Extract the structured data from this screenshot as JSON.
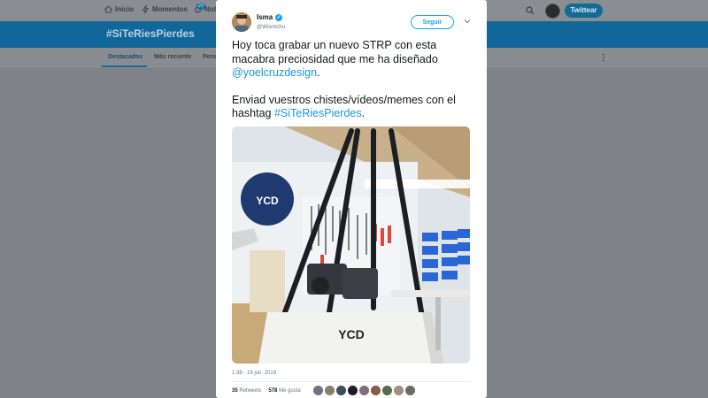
{
  "topnav": {
    "items": [
      {
        "label": "Inicio",
        "icon": "home-icon"
      },
      {
        "label": "Momentos",
        "icon": "lightning-icon"
      },
      {
        "label": "Noti",
        "icon": "bell-icon"
      }
    ],
    "notification_badge": "20",
    "tweet_button": "Twittear"
  },
  "banner": {
    "title": "#SiTeRiesPierdes"
  },
  "subtabs": [
    "Destacados",
    "Más reciente",
    "Pers"
  ],
  "tweet": {
    "author_name": "Isma",
    "author_handle": "@Wismichu",
    "follow_label": "Seguir",
    "paragraph1_text": "Hoy toca grabar un nuevo STRP con esta macabra preciosidad que me ha diseñado ",
    "paragraph1_link": "@yoelcruzdesign",
    "paragraph1_end": ".",
    "paragraph2_text": "Enviad vuestros chistes/vídeos/memes con el hashtag ",
    "paragraph2_link": "#SiTeRiesPierdes",
    "paragraph2_end": ".",
    "photo": {
      "logo_text": "YCD"
    },
    "timestamp": "1:38 - 19 jun. 2019",
    "retweets_count": "35",
    "retweets_label": "Retweets",
    "likes_count": "578",
    "likes_label": "Me gusta"
  },
  "colors": {
    "accent": "#1da1f2",
    "banner": "#11679a",
    "link": "#1b95e0"
  }
}
